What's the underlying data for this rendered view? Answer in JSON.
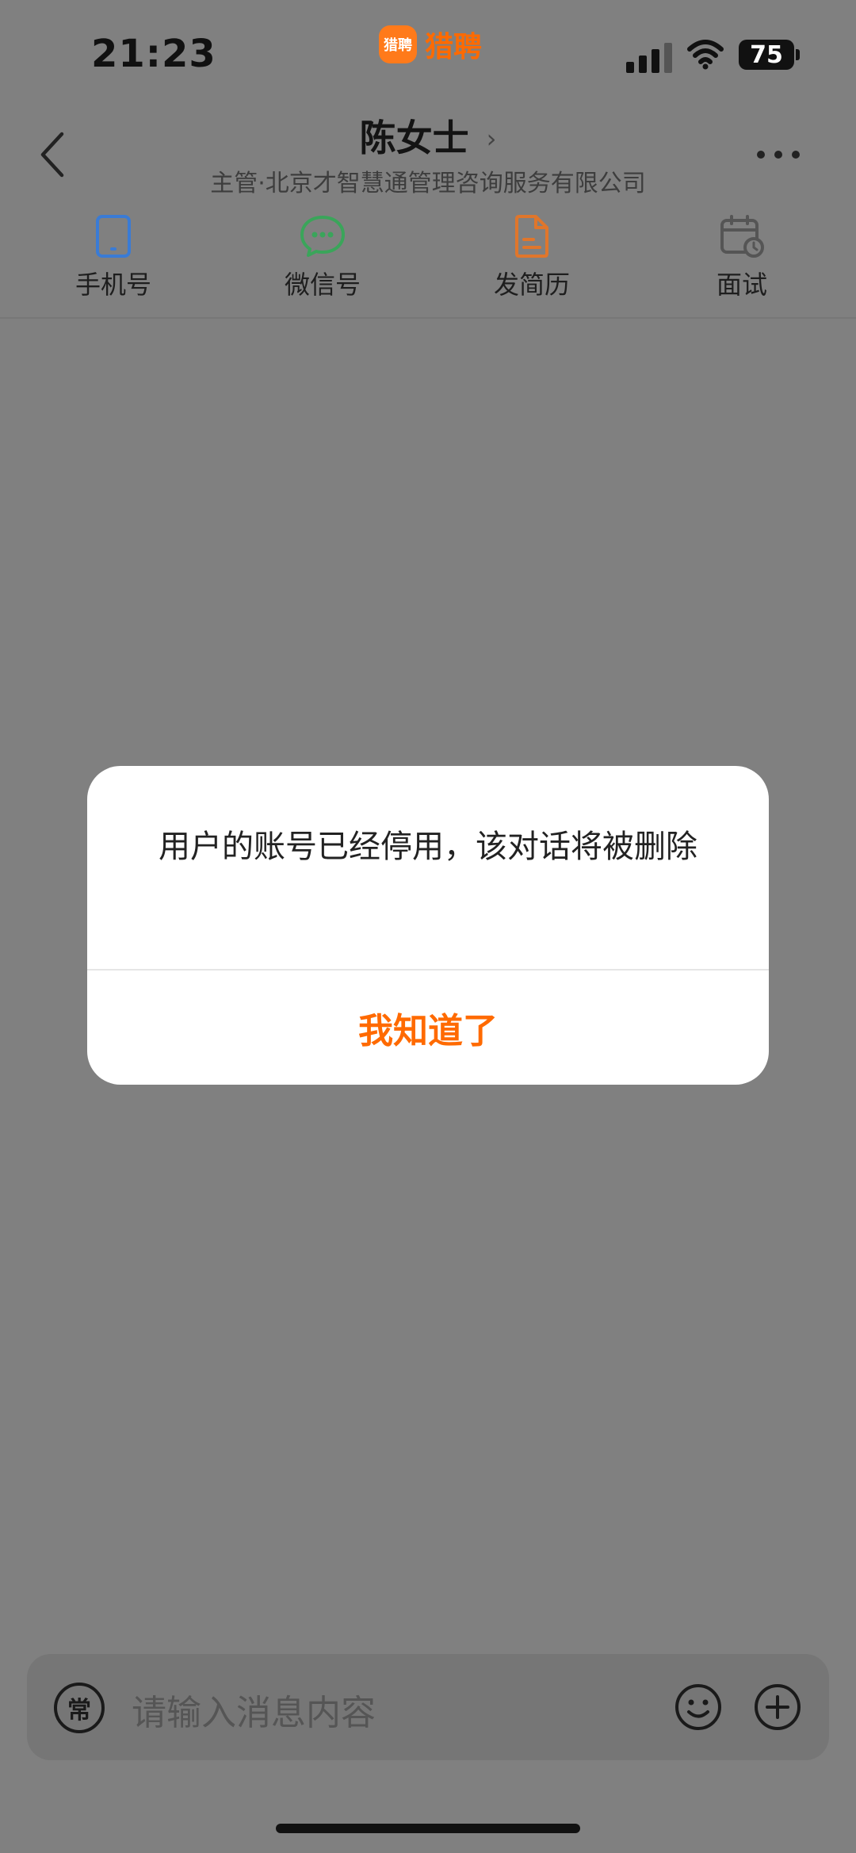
{
  "status_bar": {
    "time": "21:23",
    "app_name": "猎聘",
    "app_logo_text": "猎聘",
    "battery": "75"
  },
  "header": {
    "title": "陈女士",
    "title_chevron": "›",
    "subtitle": "主管·北京才智慧通管理咨询服务有限公司"
  },
  "quick_actions": [
    {
      "label": "手机号",
      "icon": "phone-icon",
      "color": "#3a7bd5"
    },
    {
      "label": "微信号",
      "icon": "wechat-icon",
      "color": "#3aa55a"
    },
    {
      "label": "发简历",
      "icon": "resume-icon",
      "color": "#e0762b"
    },
    {
      "label": "面试",
      "icon": "calendar-icon",
      "color": "#555555"
    }
  ],
  "modal": {
    "message": "用户的账号已经停用，该对话将被删除",
    "confirm_label": "我知道了"
  },
  "input_bar": {
    "common_label": "常",
    "placeholder": "请输入消息内容"
  },
  "colors": {
    "accent": "#ff6a00",
    "overlay": "#808080"
  }
}
